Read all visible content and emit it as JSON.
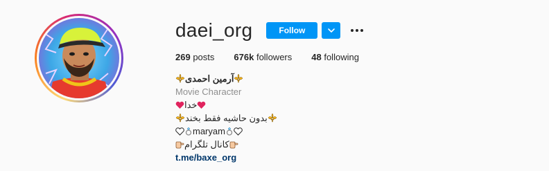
{
  "profile": {
    "username": "daei_org",
    "follow_label": "Follow"
  },
  "icons": {
    "dropdown": "chevron-down-icon",
    "more": "more-options-icon"
  },
  "stats": {
    "posts": "269",
    "posts_label": "posts",
    "followers": "676k",
    "followers_label": "followers",
    "following": "48",
    "following_label": "following"
  },
  "bio": {
    "full_name": "آرمین احمدی",
    "category": "Movie Character",
    "line1": "خدا",
    "line2": "بدون حاشیه فقط بخند",
    "line3": "maryam",
    "line4": "کانال تلگرام",
    "link": "t.me/baxe_org"
  },
  "colors": {
    "follow_button": "#0095f6",
    "link": "#00376b",
    "category": "#8e8e8e",
    "heart": "#e0245e",
    "fleur": "#f2b21c"
  }
}
